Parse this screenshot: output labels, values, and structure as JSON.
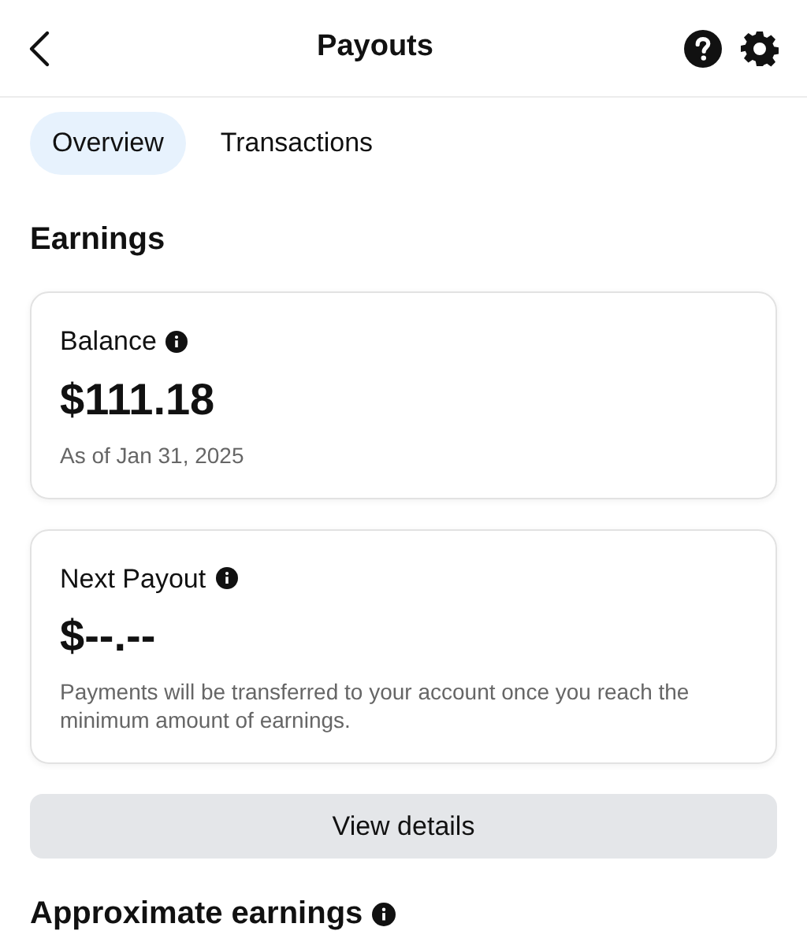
{
  "header": {
    "title": "Payouts"
  },
  "tabs": [
    {
      "label": "Overview",
      "selected": true
    },
    {
      "label": "Transactions",
      "selected": false
    }
  ],
  "section_title": "Earnings",
  "cards": [
    {
      "title": "Balance",
      "amount": "$111.18",
      "note": "As of Jan 31, 2025"
    },
    {
      "title": "Next Payout",
      "amount": "$--.--",
      "note": "Payments will be transferred to your account once you reach the minimum amount of earnings."
    }
  ],
  "button": "View details",
  "approximate_title": "Approximate earnings"
}
